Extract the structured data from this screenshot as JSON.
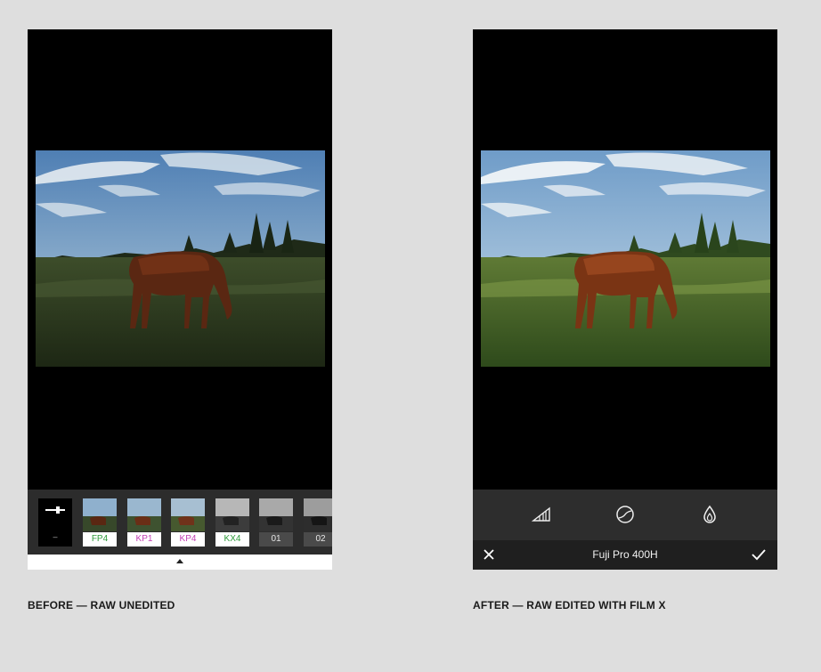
{
  "before": {
    "caption": "BEFORE — RAW UNEDITED",
    "tool_tile_label": "–",
    "presets": [
      {
        "label": "FP4",
        "color": "#2e9a3a",
        "style": "light"
      },
      {
        "label": "KP1",
        "color": "#c23fb3",
        "style": "light"
      },
      {
        "label": "KP4",
        "color": "#c23fb3",
        "style": "light"
      },
      {
        "label": "KX4",
        "color": "#2e9a3a",
        "style": "light"
      },
      {
        "label": "01",
        "color": "#e6e6e6",
        "style": "dark"
      },
      {
        "label": "02",
        "color": "#e6e6e6",
        "style": "dark"
      }
    ]
  },
  "after": {
    "caption": "AFTER — RAW EDITED WITH FILM X",
    "preset_name": "Fuji Pro 400H",
    "tools": [
      "strength-icon",
      "curve-icon",
      "tone-drop-icon"
    ]
  }
}
